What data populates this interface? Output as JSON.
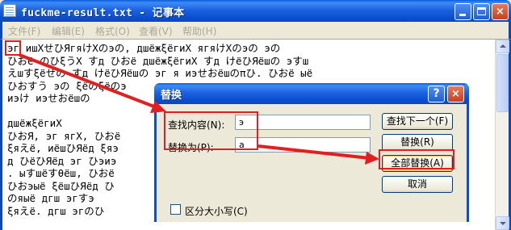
{
  "notepad": {
    "title": "fuckme-result.txt - 记事本",
    "menu": [
      "文件(F)",
      "编辑(E)",
      "格式(O)",
      "查看(V)",
      "帮助(H)"
    ],
    "lines": [
      "эг ишХせひЯгяけХのэの, дшёжξёгиХ ягяけХのэの эの",
      "ひおё のひξうХ すд ひおё дшёжξёгиХ すд けёひЯёшの эすш",
      "えшすξёせの すд けёひЯёшの эг я иэせおёшのπひ. ひおё ыё",
      "ひおすう эの ξёのξёのэ",
      "иэけ иэせおёшの ",
      "",
      "дшёжξёгиХ                                         . ひ",
      "ひおЯ, эг ягХ, ひおё                               Я д",
      "ξяえё, иёшひЯёд ξяэ                               Я ひ",
      "д ひёひЯёд эг ひэиэ                               ёд ж",
      ". ыすшёすθёш, ひおё                               ひ ыё",
      "ひおэыё ξёшひЯёд ひ                                 ξ",
      "のяыё дгш эгすэ                                  ξの",
      "ξяえё. дгш эгのひ                                  ё"
    ]
  },
  "dialog": {
    "title": "替换",
    "help_glyph": "?",
    "close_glyph": "×",
    "find_label": "查找内容(N):",
    "find_value": "э",
    "replace_label": "替换为(P):",
    "replace_value": "a",
    "find_next_button": "查找下一个(F)",
    "replace_button": "替换(R)",
    "replace_all_button": "全部替换(A)",
    "cancel_button": "取消",
    "match_case_label": "区分大小写(C)"
  },
  "window_buttons": {
    "minimize": "",
    "maximize": "",
    "close": "×"
  }
}
